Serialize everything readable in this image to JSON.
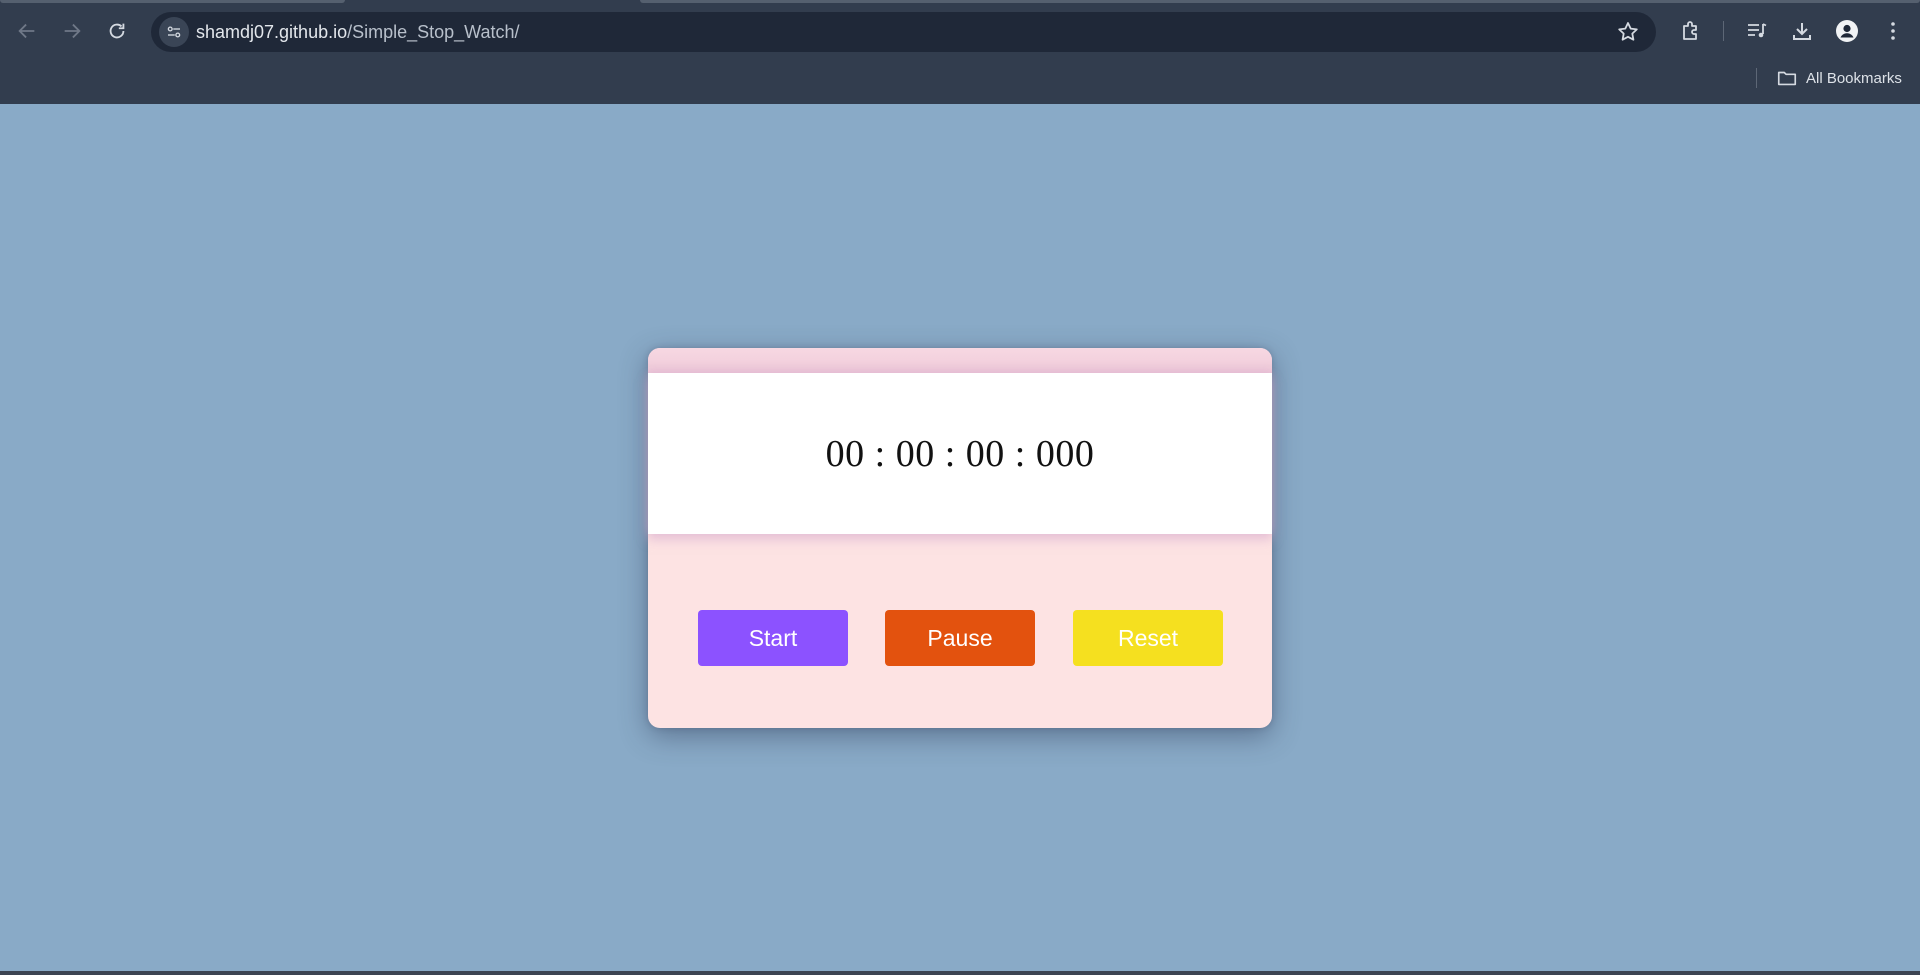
{
  "browser": {
    "url_host": "shamdj07.github.io",
    "url_path": "/Simple_Stop_Watch/",
    "bookmarks_label": "All Bookmarks",
    "icons": [
      "back-icon",
      "forward-icon",
      "reload-icon",
      "site-info-icon",
      "bookmark-star-icon",
      "extensions-icon",
      "media-control-icon",
      "download-icon",
      "profile-icon",
      "menu-icon",
      "folder-icon"
    ]
  },
  "stopwatch": {
    "time": "00 : 00 : 00 : 000",
    "buttons": {
      "start": {
        "label": "Start",
        "color": "#8c52ff"
      },
      "pause": {
        "label": "Pause",
        "color": "#e3520e"
      },
      "reset": {
        "label": "Reset",
        "color": "#f5e01f"
      }
    }
  },
  "colors": {
    "page_background": "#89aac7",
    "card_background": "#fde3e3",
    "display_background": "#ffffff",
    "chrome_background": "#323d4e",
    "omnibox_background": "#1f2838"
  }
}
